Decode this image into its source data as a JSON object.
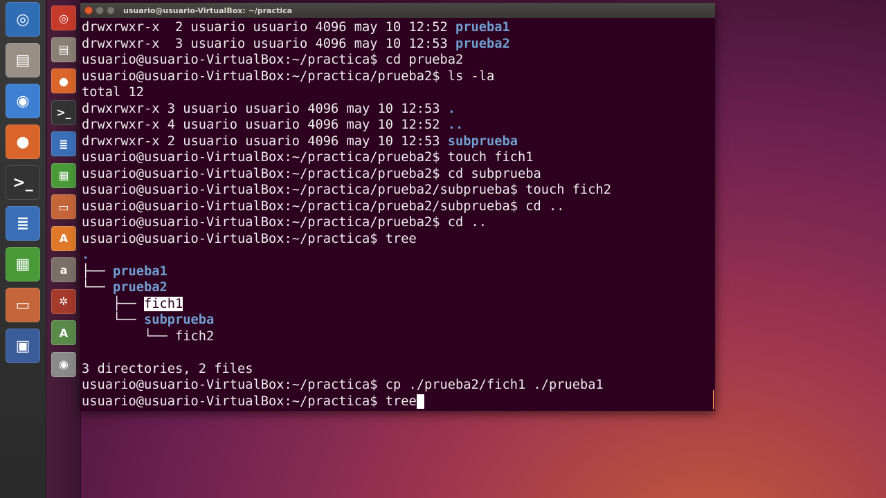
{
  "window": {
    "title": "usuario@usuario-VirtualBox: ~/practica"
  },
  "host_launcher": [
    {
      "name": "ubuntu-dash",
      "glyph": "◎",
      "bg": "#2f6db5"
    },
    {
      "name": "files",
      "glyph": "▤",
      "bg": "#9a8f84"
    },
    {
      "name": "chrome",
      "glyph": "◉",
      "bg": "#3d7fd1"
    },
    {
      "name": "firefox",
      "glyph": "●",
      "bg": "#d9652a"
    },
    {
      "name": "terminal",
      "glyph": ">_",
      "bg": "#333333"
    },
    {
      "name": "writer",
      "glyph": "≣",
      "bg": "#3a6fb8"
    },
    {
      "name": "calc",
      "glyph": "▦",
      "bg": "#4a9a3a"
    },
    {
      "name": "impress",
      "glyph": "▭",
      "bg": "#c4653a"
    },
    {
      "name": "virtualbox",
      "glyph": "▣",
      "bg": "#3a5d9a"
    }
  ],
  "guest_launcher": [
    {
      "name": "ubuntu-dash",
      "glyph": "◎",
      "bg": "#c63a2a"
    },
    {
      "name": "files",
      "glyph": "▤",
      "bg": "#8a8076"
    },
    {
      "name": "firefox",
      "glyph": "●",
      "bg": "#d9652a"
    },
    {
      "name": "terminal",
      "glyph": ">_",
      "bg": "#333333"
    },
    {
      "name": "writer",
      "glyph": "≣",
      "bg": "#3a6fb8"
    },
    {
      "name": "calc",
      "glyph": "▦",
      "bg": "#4a9a3a"
    },
    {
      "name": "impress",
      "glyph": "▭",
      "bg": "#c4653a"
    },
    {
      "name": "software-center",
      "glyph": "A",
      "bg": "#e07a2a"
    },
    {
      "name": "amazon",
      "glyph": "a",
      "bg": "#7a7068"
    },
    {
      "name": "settings",
      "glyph": "✲",
      "bg": "#a33a2a"
    },
    {
      "name": "updater",
      "glyph": "A",
      "bg": "#5a8a4a"
    },
    {
      "name": "dvd",
      "glyph": "◉",
      "bg": "#8a8a8a"
    }
  ],
  "terminal": {
    "lines": [
      {
        "segments": [
          {
            "t": "drwxrwxr-x  2 usuario usuario 4096 may 10 12:52 "
          },
          {
            "t": "prueba1",
            "c": "bold-dir"
          }
        ]
      },
      {
        "segments": [
          {
            "t": "drwxrwxr-x  3 usuario usuario 4096 may 10 12:53 "
          },
          {
            "t": "prueba2",
            "c": "bold-dir"
          }
        ]
      },
      {
        "segments": [
          {
            "t": "usuario@usuario-VirtualBox:~/practica$ cd prueba2"
          }
        ]
      },
      {
        "segments": [
          {
            "t": "usuario@usuario-VirtualBox:~/practica/prueba2$ ls -la"
          }
        ]
      },
      {
        "segments": [
          {
            "t": "total 12"
          }
        ]
      },
      {
        "segments": [
          {
            "t": "drwxrwxr-x 3 usuario usuario 4096 may 10 12:53 "
          },
          {
            "t": ".",
            "c": "bold-dir"
          }
        ]
      },
      {
        "segments": [
          {
            "t": "drwxrwxr-x 4 usuario usuario 4096 may 10 12:52 "
          },
          {
            "t": "..",
            "c": "bold-dir"
          }
        ]
      },
      {
        "segments": [
          {
            "t": "drwxrwxr-x 2 usuario usuario 4096 may 10 12:53 "
          },
          {
            "t": "subprueba",
            "c": "bold-dir"
          }
        ]
      },
      {
        "segments": [
          {
            "t": "usuario@usuario-VirtualBox:~/practica/prueba2$ touch fich1"
          }
        ]
      },
      {
        "segments": [
          {
            "t": "usuario@usuario-VirtualBox:~/practica/prueba2$ cd subprueba"
          }
        ]
      },
      {
        "segments": [
          {
            "t": "usuario@usuario-VirtualBox:~/practica/prueba2/subprueba$ touch fich2"
          }
        ]
      },
      {
        "segments": [
          {
            "t": "usuario@usuario-VirtualBox:~/practica/prueba2/subprueba$ cd .."
          }
        ]
      },
      {
        "segments": [
          {
            "t": "usuario@usuario-VirtualBox:~/practica/prueba2$ cd .."
          }
        ]
      },
      {
        "segments": [
          {
            "t": "usuario@usuario-VirtualBox:~/practica$ tree"
          }
        ]
      },
      {
        "segments": [
          {
            "t": ".",
            "c": "bold-dir"
          }
        ]
      },
      {
        "segments": [
          {
            "t": "├── "
          },
          {
            "t": "prueba1",
            "c": "bold-dir"
          }
        ]
      },
      {
        "segments": [
          {
            "t": "└── "
          },
          {
            "t": "prueba2",
            "c": "bold-dir"
          }
        ]
      },
      {
        "segments": [
          {
            "t": "    ├── "
          },
          {
            "t": "fich1",
            "c": "hl"
          }
        ]
      },
      {
        "segments": [
          {
            "t": "    └── "
          },
          {
            "t": "subprueba",
            "c": "bold-dir"
          }
        ]
      },
      {
        "segments": [
          {
            "t": "        └── fich2"
          }
        ]
      },
      {
        "segments": [
          {
            "t": ""
          }
        ]
      },
      {
        "segments": [
          {
            "t": "3 directories, 2 files"
          }
        ]
      },
      {
        "segments": [
          {
            "t": "usuario@usuario-VirtualBox:~/practica$ cp ./prueba2/fich1 ./prueba1"
          }
        ]
      },
      {
        "segments": [
          {
            "t": "usuario@usuario-VirtualBox:~/practica$ tree"
          }
        ],
        "cursor": true
      }
    ]
  },
  "colors": {
    "terminal_bg": "#2c001e",
    "dir_blue": "#729fcf",
    "close_btn": "#e25c2e",
    "min_btn": "#77756f",
    "max_btn": "#77756f"
  }
}
